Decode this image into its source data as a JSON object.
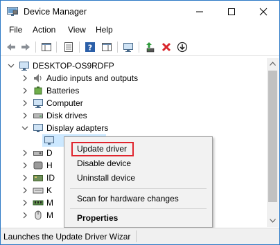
{
  "window": {
    "title": "Device Manager",
    "border_color": "#2b78c5"
  },
  "menubar": {
    "items": [
      "File",
      "Action",
      "View",
      "Help"
    ]
  },
  "toolbar": {
    "icons": [
      "back-arrow-icon",
      "forward-arrow-icon",
      "show-hide-console-tree-icon",
      "properties-icon",
      "help-icon",
      "action-pane-icon",
      "monitor-icon",
      "update-driver-icon",
      "uninstall-x-icon",
      "download-circle-icon"
    ]
  },
  "tree": {
    "root": "DESKTOP-OS9RDFP",
    "categories": [
      {
        "label": "Audio inputs and outputs",
        "icon": "speaker-icon"
      },
      {
        "label": "Batteries",
        "icon": "battery-icon"
      },
      {
        "label": "Computer",
        "icon": "computer-icon"
      },
      {
        "label": "Disk drives",
        "icon": "disk-drive-icon"
      },
      {
        "label": "Display adapters",
        "icon": "display-adapter-icon",
        "expanded": true
      }
    ],
    "partial_rows": [
      "D",
      "H",
      "ID",
      "K",
      "M",
      "M"
    ]
  },
  "context_menu": {
    "items": [
      {
        "label": "Update driver",
        "highlighted": true
      },
      {
        "label": "Disable device"
      },
      {
        "label": "Uninstall device"
      },
      {
        "label": "Scan for hardware changes"
      },
      {
        "label": "Properties",
        "bold": true
      }
    ],
    "highlight_color": "#e0242d"
  },
  "statusbar": {
    "text": "Launches the Update Driver Wizar"
  },
  "colors": {
    "selection": "#cce8ff",
    "uninstall_red": "#d9262c"
  }
}
